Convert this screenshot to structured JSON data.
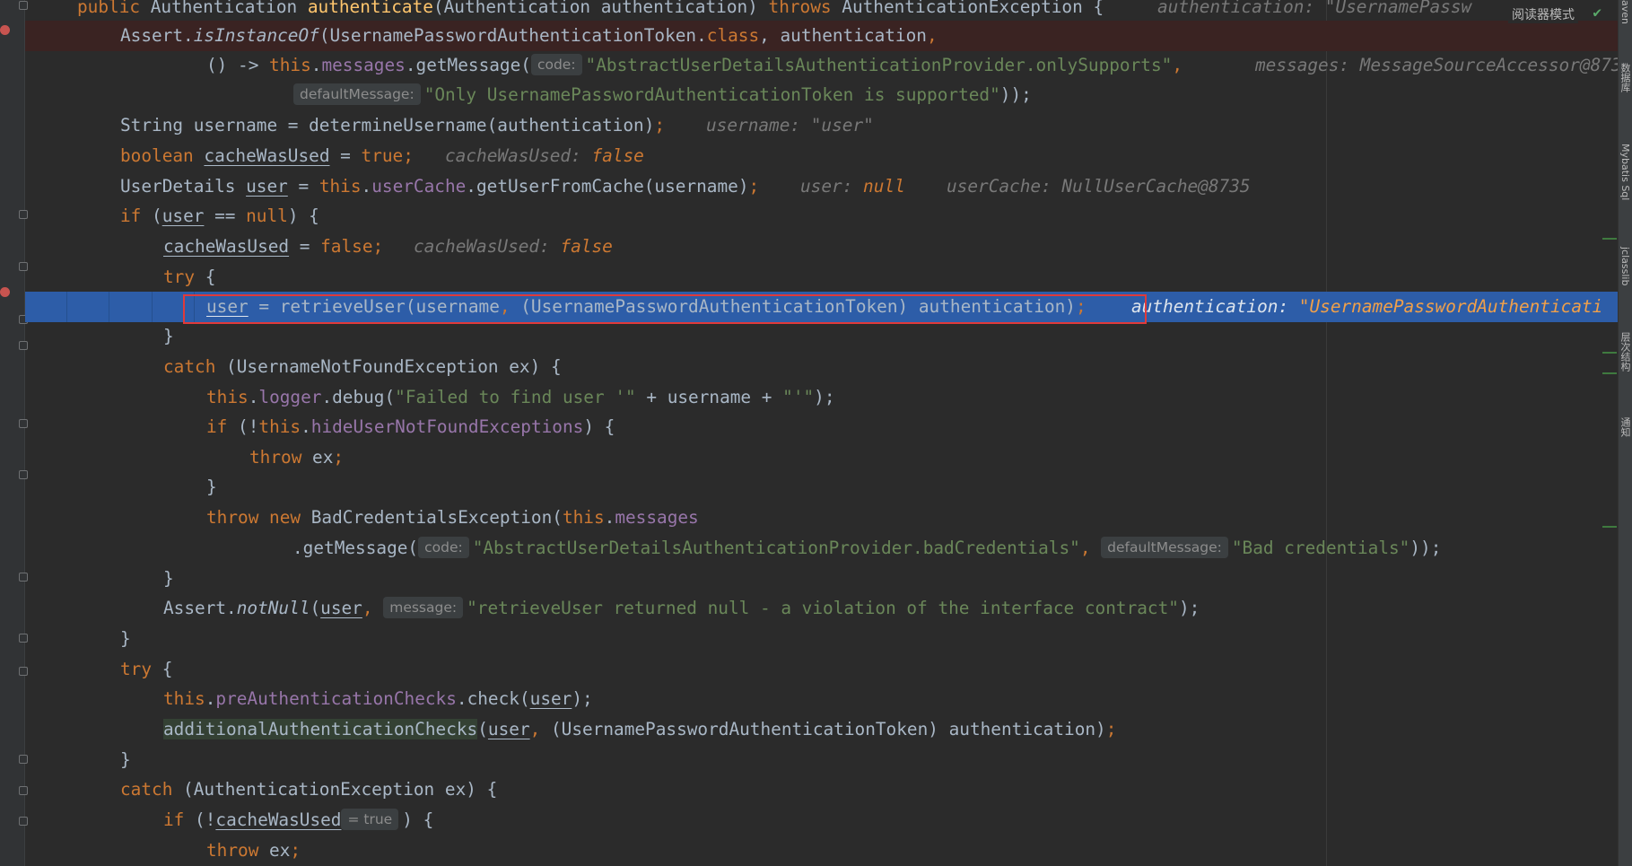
{
  "toolbar": {
    "reader_mode": "阅读器模式"
  },
  "right_strip": {
    "items": [
      "aven",
      "数据库",
      "Mybatis Sql",
      "jclasslib",
      "层次结构",
      "通知"
    ]
  },
  "hints": {
    "code": "code:",
    "default_message": "defaultMessage:",
    "message": "message:",
    "true_val": "= true"
  },
  "lines": {
    "l1": {
      "a": "public ",
      "b": "Authentication ",
      "c": "authenticate",
      "d": "(Authentication authentication) ",
      "e": "throws ",
      "f": "AuthenticationException {",
      "dbg": "authentication: \"UsernamePassw"
    },
    "l2": {
      "a": "Assert.",
      "b": "isInstanceOf",
      "c": "(UsernamePasswordAuthenticationToken.",
      "d": "class",
      "e": ", authentication",
      "f": ","
    },
    "l3": {
      "a": "() -> ",
      "b": "this",
      "c": ".",
      "d": "messages",
      "e": ".getMessage(",
      "s": "\"AbstractUserDetailsAuthenticationProvider.onlySupports\"",
      "f": ",",
      "dbg": "messages: MessageSourceAccessor@873"
    },
    "l4": {
      "s": "\"Only UsernamePasswordAuthenticationToken is supported\"",
      "f": "));"
    },
    "l5": {
      "a": "String username = determineUsername(authentication)",
      "f": ";",
      "dbg_k": "username: ",
      "dbg_v": "\"user\""
    },
    "l6": {
      "a": "boolean ",
      "b": "cacheWasUsed",
      "c": " = ",
      "d": "true",
      "f": ";",
      "dbg_k": "cacheWasUsed: ",
      "dbg_v": "false"
    },
    "l7": {
      "a": "UserDetails ",
      "b": "user",
      "c": " = ",
      "d": "this",
      "e": ".",
      "g": "userCache",
      "h": ".getUserFromCache(username)",
      "f": ";",
      "dbg_k": "user: ",
      "dbg_v": "null",
      "dbg2": "userCache: NullUserCache@8735"
    },
    "l8": {
      "a": "if ",
      "b": "(",
      "c": "user",
      "d": " == ",
      "e": "null",
      "f": ") {"
    },
    "l9": {
      "a": "cacheWasUsed",
      "b": " = ",
      "c": "false",
      "f": ";",
      "dbg_k": "cacheWasUsed: ",
      "dbg_v": "false"
    },
    "l10": {
      "a": "try ",
      "b": "{"
    },
    "l11": {
      "a": "user",
      "b": " = retrieveUser(username",
      "c": ", ",
      "d": "(UsernamePasswordAuthenticationToken) authentication)",
      "f": ";",
      "dbg_k": "authentication: ",
      "dbg_v": "\"UsernamePasswordAuthenticati"
    },
    "l12": {
      "a": "}"
    },
    "l13": {
      "a": "catch ",
      "b": "(UsernameNotFoundException ex) {"
    },
    "l14": {
      "a": "this",
      "b": ".",
      "c": "logger",
      "d": ".debug(",
      "s": "\"Failed to find user '\"",
      "e": " + username + ",
      "s2": "\"'\"",
      "f": ");"
    },
    "l15": {
      "a": "if ",
      "b": "(!",
      "c": "this",
      "d": ".",
      "e": "hideUserNotFoundExceptions",
      "f": ") {"
    },
    "l16": {
      "a": "throw ",
      "b": "ex",
      "f": ";"
    },
    "l17": {
      "a": "}"
    },
    "l18": {
      "a": "throw new ",
      "b": "BadCredentialsException(",
      "c": "this",
      "d": ".",
      "e": "messages"
    },
    "l19": {
      "a": ".getMessage(",
      "s": "\"AbstractUserDetailsAuthenticationProvider.badCredentials\"",
      "b": ", ",
      "s2": "\"Bad credentials\"",
      "f": "));"
    },
    "l20": {
      "a": "}"
    },
    "l21": {
      "a": "Assert.",
      "b": "notNull",
      "c": "(",
      "d": "user",
      "e": ", ",
      "s": "\"retrieveUser returned null - a violation of the interface contract\"",
      "f": ");"
    },
    "l22": {
      "a": "}"
    },
    "l23": {
      "a": "try ",
      "b": "{"
    },
    "l24": {
      "a": "this",
      "b": ".",
      "c": "preAuthenticationChecks",
      "d": ".check(",
      "e": "user",
      "f": ");"
    },
    "l25": {
      "a": "additionalAuthenticationChecks",
      "b": "(",
      "c": "user",
      "d": ", ",
      "e": "(UsernamePasswordAuthenticationToken) authentication)",
      "f": ";"
    },
    "l26": {
      "a": "}"
    },
    "l27": {
      "a": "catch ",
      "b": "(AuthenticationException ex) {"
    },
    "l28": {
      "a": "if ",
      "b": "(!",
      "c": "cacheWasUsed",
      "d": ") {"
    },
    "l29": {
      "a": "throw ",
      "b": "ex",
      "f": ";"
    }
  }
}
